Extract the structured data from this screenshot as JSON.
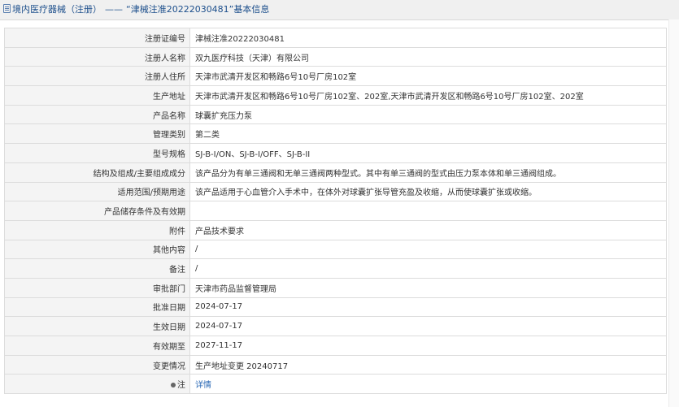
{
  "header": {
    "category": "境内医疗器械（注册）",
    "separator": "——",
    "title": "“津械注准20222030481”基本信息"
  },
  "rows": [
    {
      "label": "注册证编号",
      "value": "津械注准20222030481"
    },
    {
      "label": "注册人名称",
      "value": "双九医疗科技（天津）有限公司"
    },
    {
      "label": "注册人住所",
      "value": "天津市武清开发区和畅路6号10号厂房102室"
    },
    {
      "label": "生产地址",
      "value": "天津市武清开发区和畅路6号10号厂房102室、202室,天津市武清开发区和畅路6号10号厂房102室、202室"
    },
    {
      "label": "产品名称",
      "value": "球囊扩充压力泵"
    },
    {
      "label": "管理类别",
      "value": "第二类"
    },
    {
      "label": "型号规格",
      "value": "SJ-B-I/ON、SJ-B-I/OFF、SJ-B-II"
    },
    {
      "label": "结构及组成/主要组成成分",
      "value": "该产品分为有单三通阀和无单三通阀两种型式。其中有单三通阀的型式由压力泵本体和单三通阀组成。"
    },
    {
      "label": "适用范围/预期用途",
      "value": "该产品适用于心血管介入手术中，在体外对球囊扩张导管充盈及收缩，从而使球囊扩张或收缩。"
    },
    {
      "label": "产品储存条件及有效期",
      "value": ""
    },
    {
      "label": "附件",
      "value": "产品技术要求"
    },
    {
      "label": "其他内容",
      "value": "/"
    },
    {
      "label": "备注",
      "value": "/"
    },
    {
      "label": "审批部门",
      "value": "天津市药品监督管理局"
    },
    {
      "label": "批准日期",
      "value": "2024-07-17"
    },
    {
      "label": "生效日期",
      "value": "2024-07-17"
    },
    {
      "label": "有效期至",
      "value": "2027-11-17"
    },
    {
      "label": "变更情况",
      "value": "生产地址变更 20240717"
    }
  ],
  "note": {
    "label": "注",
    "link_text": "详情"
  }
}
